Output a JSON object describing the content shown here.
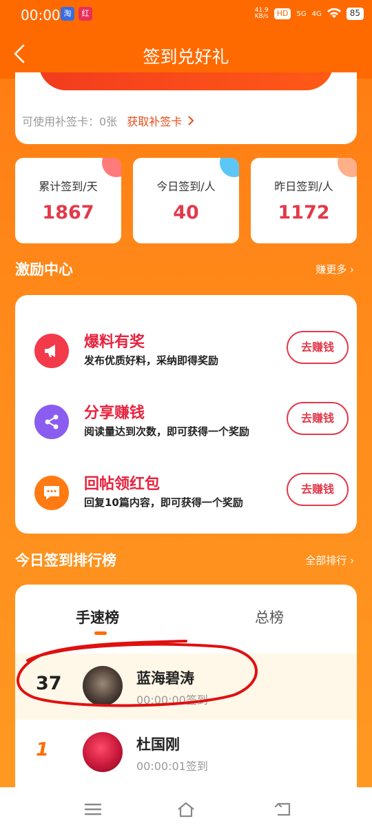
{
  "status_bar": {
    "time": "00:00",
    "app_icon_1": "淘",
    "app_icon_2": "红",
    "net_speed": "41.9",
    "net_unit": "KB/s",
    "hd": "HD",
    "sig1": "5G",
    "sig2": "4G",
    "battery": "85"
  },
  "nav": {
    "title": "签到兑好礼"
  },
  "top_card": {
    "makeup_label": "可使用补签卡：0张",
    "get_card_link": "获取补签卡"
  },
  "stats": [
    {
      "label": "累计签到/天",
      "value": "1867",
      "corner_color": "#ff7a7a"
    },
    {
      "label": "今日签到/人",
      "value": "40",
      "corner_color": "#5cc7f5"
    },
    {
      "label": "昨日签到/人",
      "value": "1172",
      "corner_color": "#ffb08a"
    }
  ],
  "incentive": {
    "title": "激励中心",
    "more": "赚更多",
    "tasks": [
      {
        "title": "爆料有奖",
        "desc": "发布优质好料，采纳即得奖励",
        "button": "去赚钱",
        "icon": "megaphone-icon",
        "color": "#f23a4a"
      },
      {
        "title": "分享赚钱",
        "desc": "阅读量达到次数，即可获得一个奖励",
        "button": "去赚钱",
        "icon": "share-icon",
        "color": "#8a5cf0"
      },
      {
        "title": "回帖领红包",
        "desc": "回复10篇内容，即可获得一个奖励",
        "button": "去赚钱",
        "icon": "chat-icon",
        "color": "#ff7a12"
      }
    ]
  },
  "ranking": {
    "title": "今日签到排行榜",
    "more": "全部排行",
    "tabs": [
      "手速榜",
      "总榜"
    ],
    "rows": [
      {
        "rank": "37",
        "name": "蓝海碧涛",
        "time": "00:00:00签到"
      },
      {
        "rank": "1",
        "name": "杜国刚",
        "time": "00:00:01签到"
      }
    ]
  },
  "colors": {
    "brand": "#ff6a00",
    "accent_red": "#e23a4a"
  }
}
